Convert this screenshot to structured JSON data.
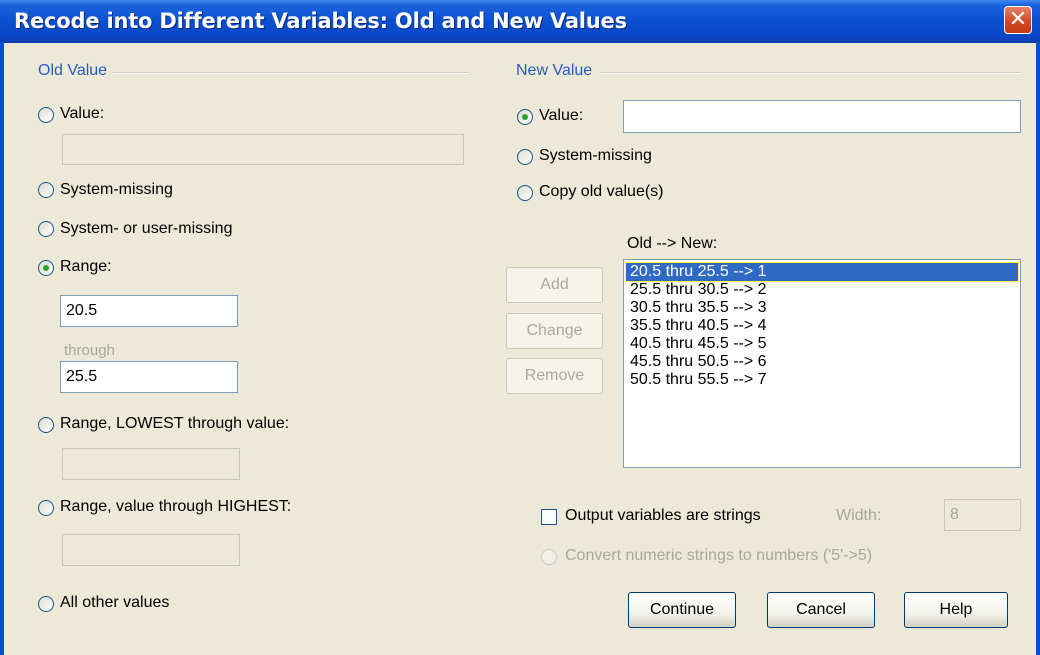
{
  "window": {
    "title": "Recode into Different Variables: Old and New Values"
  },
  "old_value": {
    "group_label": "Old Value",
    "value_label": "Value:",
    "value_input": "",
    "system_missing_label": "System-missing",
    "system_or_user_missing_label": "System- or user-missing",
    "range_label": "Range:",
    "range_from": "20.5",
    "through_label": "through",
    "range_to": "25.5",
    "range_lowest_label": "Range, LOWEST through value:",
    "range_lowest_input": "",
    "range_highest_label": "Range, value through HIGHEST:",
    "range_highest_input": "",
    "all_other_label": "All other values",
    "selected": "range"
  },
  "new_value": {
    "group_label": "New Value",
    "value_label": "Value:",
    "value_input": "",
    "system_missing_label": "System-missing",
    "copy_old_label": "Copy old value(s)",
    "selected": "value"
  },
  "mapping": {
    "label": "Old --> New:",
    "items": [
      "20.5 thru 25.5 --> 1",
      "25.5 thru 30.5 --> 2",
      "30.5 thru 35.5 --> 3",
      "35.5 thru 40.5 --> 4",
      "40.5 thru 45.5 --> 5",
      "45.5 thru 50.5 --> 6",
      "50.5 thru 55.5 --> 7"
    ],
    "selected_index": 0
  },
  "buttons": {
    "add": "Add",
    "change": "Change",
    "remove": "Remove",
    "continue": "Continue",
    "cancel": "Cancel",
    "help": "Help"
  },
  "options": {
    "output_strings_label": "Output variables are strings",
    "output_strings_checked": false,
    "width_label": "Width:",
    "width_value": "8",
    "convert_label": "Convert numeric strings to numbers ('5'->5)"
  },
  "colors": {
    "title_bar": "#0a4fd0",
    "group_title": "#2a5abb",
    "selection": "#316ac5"
  },
  "icons": {
    "close": "close-icon"
  }
}
